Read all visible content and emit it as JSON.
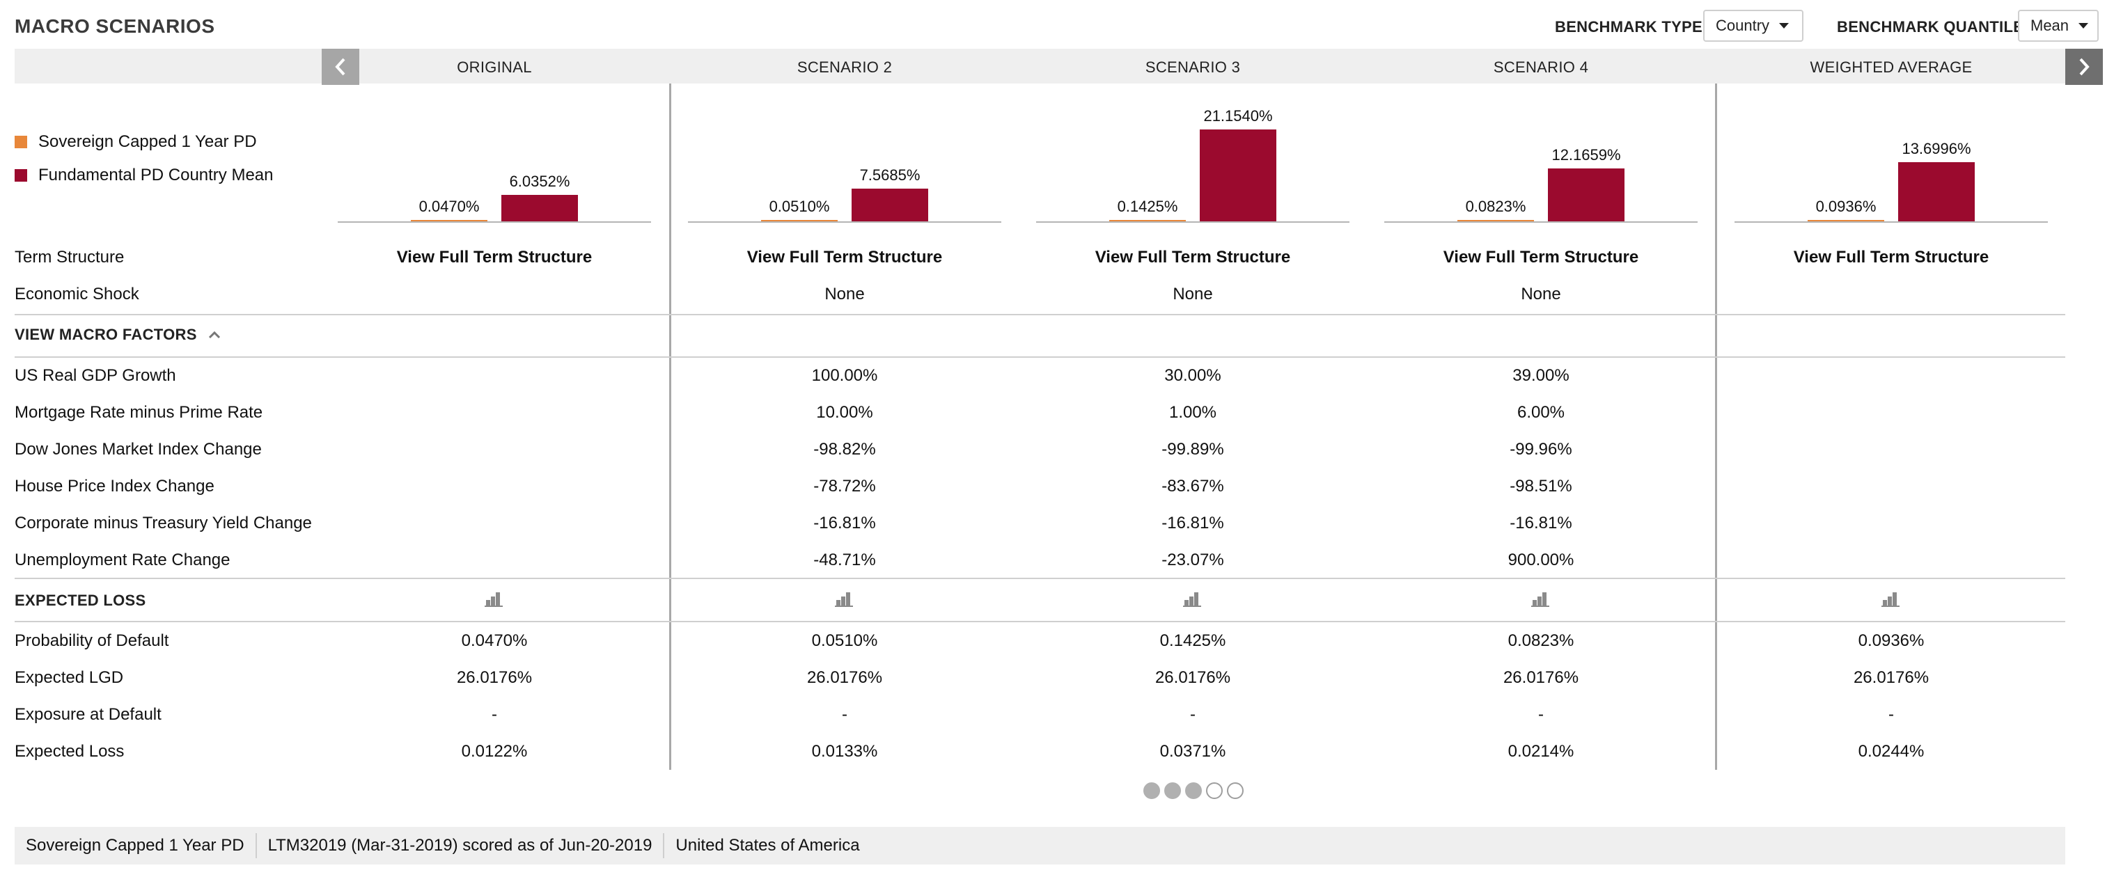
{
  "title": "MACRO SCENARIOS",
  "benchmark": {
    "type_label": "BENCHMARK TYPE",
    "type_value": "Country",
    "quantile_label": "BENCHMARK QUANTILE",
    "quantile_value": "Mean"
  },
  "columns": [
    "ORIGINAL",
    "SCENARIO 2",
    "SCENARIO 3",
    "SCENARIO 4",
    "WEIGHTED AVERAGE"
  ],
  "legend": [
    {
      "label": "Sovereign Capped 1 Year PD",
      "color": "#e8873a"
    },
    {
      "label": "Fundamental PD Country Mean",
      "color": "#9b0a2e"
    }
  ],
  "chart_data": {
    "type": "bar",
    "series_names": [
      "Sovereign Capped 1 Year PD",
      "Fundamental PD Country Mean"
    ],
    "colors": [
      "#e8873a",
      "#9b0a2e"
    ],
    "groups": [
      {
        "column": "ORIGINAL",
        "values": [
          0.047,
          6.0352
        ],
        "labels": [
          "0.0470%",
          "6.0352%"
        ]
      },
      {
        "column": "SCENARIO 2",
        "values": [
          0.051,
          7.5685
        ],
        "labels": [
          "0.0510%",
          "7.5685%"
        ]
      },
      {
        "column": "SCENARIO 3",
        "values": [
          0.1425,
          21.154
        ],
        "labels": [
          "0.1425%",
          "21.1540%"
        ]
      },
      {
        "column": "SCENARIO 4",
        "values": [
          0.0823,
          12.1659
        ],
        "labels": [
          "0.0823%",
          "12.1659%"
        ]
      },
      {
        "column": "WEIGHTED AVERAGE",
        "values": [
          0.0936,
          13.6996
        ],
        "labels": [
          "0.0936%",
          "13.6996%"
        ]
      }
    ],
    "ylim": [
      0,
      21.154
    ]
  },
  "term_structure": {
    "label": "Term Structure",
    "link": "View Full Term Structure"
  },
  "economic_shock": {
    "label": "Economic Shock",
    "values": [
      "",
      "None",
      "None",
      "None",
      ""
    ]
  },
  "macro_factors": {
    "header": "VIEW MACRO FACTORS",
    "rows": [
      {
        "label": "US Real GDP Growth",
        "values": [
          "",
          "100.00%",
          "30.00%",
          "39.00%",
          ""
        ]
      },
      {
        "label": "Mortgage Rate minus Prime Rate",
        "values": [
          "",
          "10.00%",
          "1.00%",
          "6.00%",
          ""
        ]
      },
      {
        "label": "Dow Jones Market Index Change",
        "values": [
          "",
          "-98.82%",
          "-99.89%",
          "-99.96%",
          ""
        ]
      },
      {
        "label": "House Price Index Change",
        "values": [
          "",
          "-78.72%",
          "-83.67%",
          "-98.51%",
          ""
        ]
      },
      {
        "label": "Corporate minus Treasury Yield Change",
        "values": [
          "",
          "-16.81%",
          "-16.81%",
          "-16.81%",
          ""
        ]
      },
      {
        "label": "Unemployment Rate Change",
        "values": [
          "",
          "-48.71%",
          "-23.07%",
          "900.00%",
          ""
        ]
      }
    ]
  },
  "expected_loss": {
    "header": "EXPECTED LOSS",
    "rows": [
      {
        "label": "Probability of Default",
        "values": [
          "0.0470%",
          "0.0510%",
          "0.1425%",
          "0.0823%",
          "0.0936%"
        ]
      },
      {
        "label": "Expected LGD",
        "values": [
          "26.0176%",
          "26.0176%",
          "26.0176%",
          "26.0176%",
          "26.0176%"
        ]
      },
      {
        "label": "Exposure at Default",
        "values": [
          "-",
          "-",
          "-",
          "-",
          "-"
        ]
      },
      {
        "label": "Expected Loss",
        "values": [
          "0.0122%",
          "0.0133%",
          "0.0371%",
          "0.0214%",
          "0.0244%"
        ]
      }
    ]
  },
  "pagination": {
    "total": 5,
    "filled": 3
  },
  "footer": [
    "Sovereign Capped 1 Year PD",
    "LTM32019 (Mar-31-2019) scored as of Jun-20-2019",
    "United States of America"
  ],
  "icons": {
    "prev": "chevron-left-icon",
    "next": "chevron-right-icon",
    "collapse": "chevron-up-icon",
    "chart": "bar-chart-icon"
  }
}
